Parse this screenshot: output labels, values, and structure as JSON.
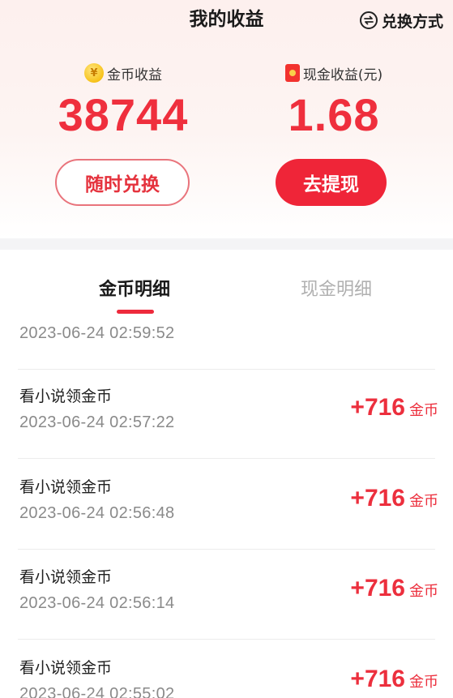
{
  "header": {
    "title": "我的收益",
    "exchange_mode_label": "兑换方式",
    "exchange_icon_glyph": "⇄"
  },
  "stats": {
    "coins": {
      "label": "金币收益",
      "value": "38744",
      "icon_glyph": "¥"
    },
    "cash": {
      "label": "现金收益(元)",
      "value": "1.68"
    }
  },
  "buttons": {
    "exchange": "随时兑换",
    "withdraw": "去提现"
  },
  "tabs": [
    {
      "label": "金币明细",
      "active": true
    },
    {
      "label": "现金明细",
      "active": false
    }
  ],
  "records": [
    {
      "title": "",
      "time": "2023-06-24 02:59:52",
      "amount": "",
      "unit": ""
    },
    {
      "title": "看小说领金币",
      "time": "2023-06-24 02:57:22",
      "amount": "+716",
      "unit": "金币"
    },
    {
      "title": "看小说领金币",
      "time": "2023-06-24 02:56:48",
      "amount": "+716",
      "unit": "金币"
    },
    {
      "title": "看小说领金币",
      "time": "2023-06-24 02:56:14",
      "amount": "+716",
      "unit": "金币"
    },
    {
      "title": "看小说领金币",
      "time": "2023-06-24 02:55:02",
      "amount": "+716",
      "unit": "金币"
    }
  ],
  "colors": {
    "accent": "#ef2f3d",
    "muted_tab": "#b0b0b0"
  }
}
